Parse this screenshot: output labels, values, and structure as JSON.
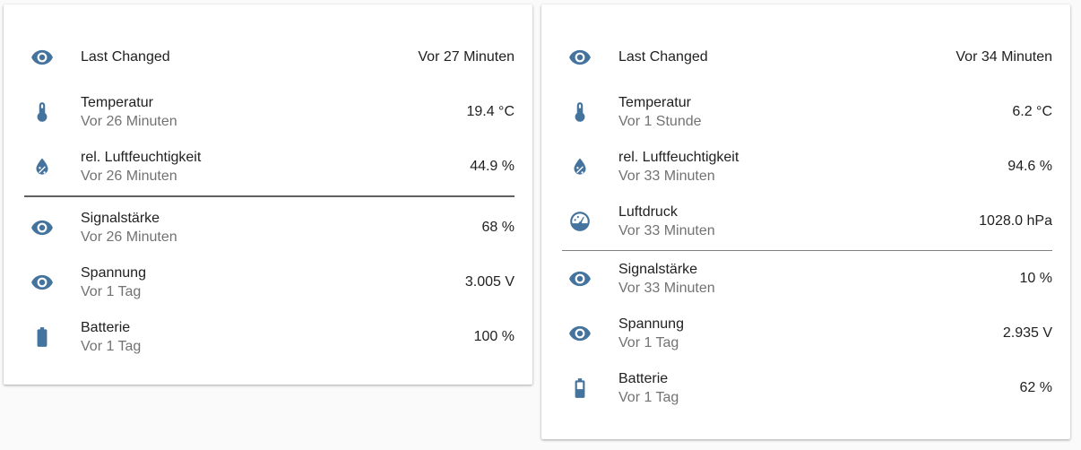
{
  "cards": [
    {
      "rows_top": [
        {
          "icon": "eye-icon",
          "name": "Last Changed",
          "secondary": "",
          "state": "Vor 27 Minuten"
        },
        {
          "icon": "thermometer-icon",
          "name": "Temperatur",
          "secondary": "Vor 26 Minuten",
          "state": "19.4 °C"
        },
        {
          "icon": "water-percent-icon",
          "name": "rel. Luftfeuchtigkeit",
          "secondary": "Vor 26 Minuten",
          "state": "44.9 %"
        }
      ],
      "rows_bottom": [
        {
          "icon": "eye-icon",
          "name": "Signalstärke",
          "secondary": "Vor 26 Minuten",
          "state": "68 %"
        },
        {
          "icon": "eye-icon",
          "name": "Spannung",
          "secondary": "Vor 1 Tag",
          "state": "3.005 V"
        },
        {
          "icon": "battery-icon",
          "name": "Batterie",
          "secondary": "Vor 1 Tag",
          "state": "100 %"
        }
      ]
    },
    {
      "rows_top": [
        {
          "icon": "eye-icon",
          "name": "Last Changed",
          "secondary": "",
          "state": "Vor 34 Minuten"
        },
        {
          "icon": "thermometer-icon",
          "name": "Temperatur",
          "secondary": "Vor 1 Stunde",
          "state": "6.2 °C"
        },
        {
          "icon": "water-percent-icon",
          "name": "rel. Luftfeuchtigkeit",
          "secondary": "Vor 33 Minuten",
          "state": "94.6 %"
        },
        {
          "icon": "gauge-icon",
          "name": "Luftdruck",
          "secondary": "Vor 33 Minuten",
          "state": "1028.0 hPa"
        }
      ],
      "rows_bottom": [
        {
          "icon": "eye-icon",
          "name": "Signalstärke",
          "secondary": "Vor 33 Minuten",
          "state": "10 %"
        },
        {
          "icon": "eye-icon",
          "name": "Spannung",
          "secondary": "Vor 1 Tag",
          "state": "2.935 V"
        },
        {
          "icon": "battery-60-icon",
          "name": "Batterie",
          "secondary": "Vor 1 Tag",
          "state": "62 %"
        }
      ]
    }
  ],
  "colors": {
    "icon": "#44739e",
    "secondary_text": "#727272",
    "primary_text": "#212121"
  }
}
